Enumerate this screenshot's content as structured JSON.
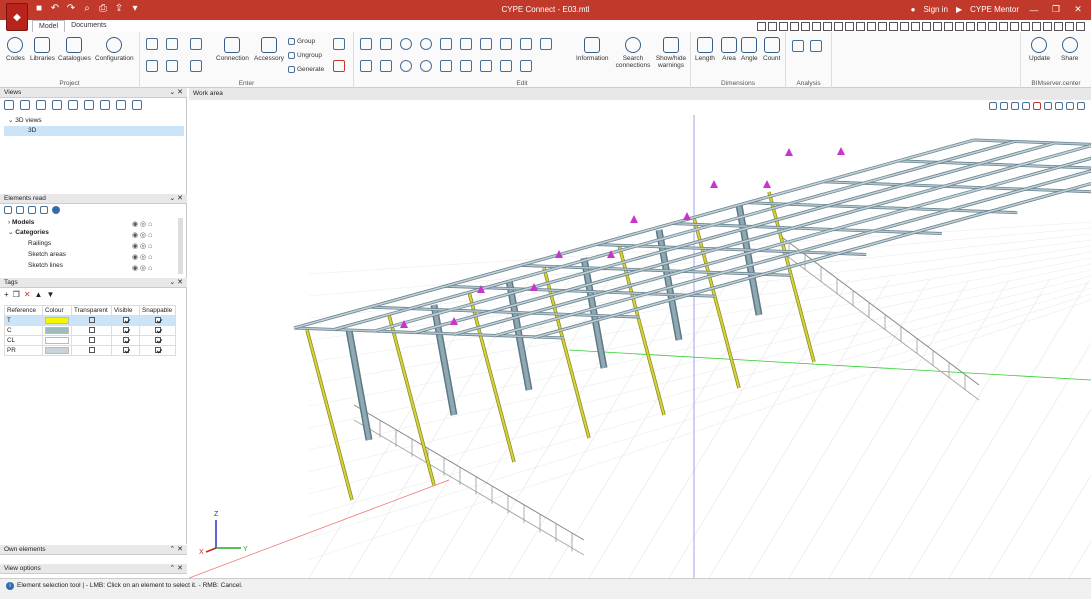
{
  "window": {
    "title": "CYPE Connect - E03.mtl",
    "sign_in": "Sign in",
    "mentor": "CYPE Mentor"
  },
  "tabs": [
    "Model",
    "Documents"
  ],
  "ribbon": {
    "project": {
      "label": "Project",
      "buttons": [
        "Codes",
        "Libraries",
        "Catalogues",
        "Configuration"
      ]
    },
    "enter": {
      "label": "Enter",
      "buttons": [
        "Connection",
        "Accessory"
      ],
      "small_buttons": [
        "Group",
        "Ungroup",
        "Generate"
      ]
    },
    "edit": {
      "label": "Edit",
      "buttons": [
        "Information",
        "Search connections",
        "Show/hide warnings"
      ]
    },
    "dimensions": {
      "label": "Dimensions",
      "buttons": [
        "Length",
        "Area",
        "Angle",
        "Count"
      ]
    },
    "analysis": {
      "label": "Analysis"
    },
    "bimserver": {
      "label": "BIMserver.center",
      "buttons": [
        "Update",
        "Share"
      ]
    }
  },
  "views_panel": {
    "title": "Views",
    "tree": [
      "3D views",
      "3D"
    ]
  },
  "elements_panel": {
    "title": "Elements read",
    "items": [
      "Models",
      "Categories",
      "Railings",
      "Sketch areas",
      "Sketch lines"
    ]
  },
  "tags_panel": {
    "title": "Tags",
    "columns": [
      "Reference",
      "Colour",
      "Transparent",
      "Visible",
      "Snappable"
    ],
    "rows": [
      {
        "ref": "T",
        "colour": "#f5f500",
        "transparent": false,
        "visible": true,
        "snappable": true
      },
      {
        "ref": "C",
        "colour": "#9dbdbd",
        "transparent": false,
        "visible": true,
        "snappable": true
      },
      {
        "ref": "CL",
        "colour": "#ffffff",
        "transparent": false,
        "visible": true,
        "snappable": true
      },
      {
        "ref": "PR",
        "colour": "#c9d3da",
        "transparent": false,
        "visible": true,
        "snappable": true
      }
    ]
  },
  "own_elements": {
    "title": "Own elements"
  },
  "view_options": {
    "title": "View options"
  },
  "work_area": {
    "title": "Work area"
  },
  "axes": {
    "z": "Z",
    "x": "X",
    "y": "Y"
  },
  "status": "Element selection tool  |  - LMB: Click on an element to select it. - RMB: Cancel.",
  "colors": {
    "accent": "#c0392b",
    "steel": "#8fa8b3",
    "brace": "#d6d33a",
    "marker": "#cc33cc"
  }
}
